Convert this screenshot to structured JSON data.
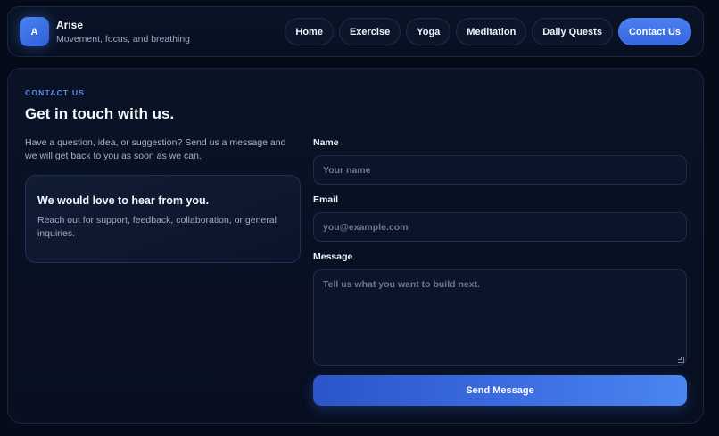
{
  "header": {
    "logo_letter": "A",
    "brand_name": "Arise",
    "tagline": "Movement, focus, and breathing",
    "nav": [
      {
        "label": "Home"
      },
      {
        "label": "Exercise"
      },
      {
        "label": "Yoga"
      },
      {
        "label": "Meditation"
      },
      {
        "label": "Daily Quests"
      },
      {
        "label": "Contact Us",
        "active": true
      }
    ]
  },
  "contact": {
    "eyebrow": "CONTACT US",
    "title": "Get in touch with us.",
    "intro": "Have a question, idea, or suggestion? Send us a message and we will get back to you as soon as we can.",
    "card": {
      "title": "We would love to hear from you.",
      "body": "Reach out for support, feedback, collaboration, or general inquiries."
    },
    "form": {
      "name_label": "Name",
      "name_placeholder": "Your name",
      "email_label": "Email",
      "email_placeholder": "you@example.com",
      "message_label": "Message",
      "message_placeholder": "Tell us what you want to build next.",
      "submit_label": "Send Message"
    }
  },
  "colors": {
    "background": "#050b18",
    "accent": "#4a7ff0",
    "eyebrow": "#5b8cf2"
  }
}
